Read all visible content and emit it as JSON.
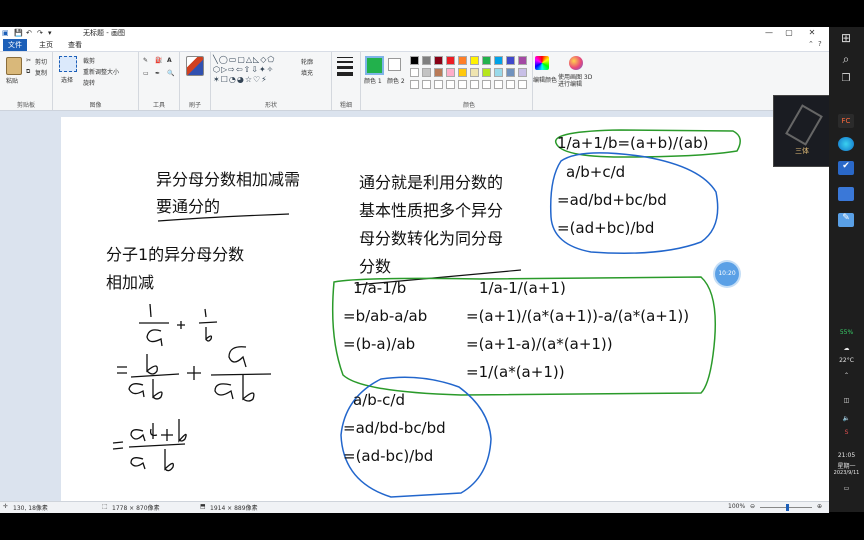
{
  "titlebar": {
    "title": "无标题 - 画图",
    "minimize": "—",
    "maximize": "▢",
    "close": "✕"
  },
  "tabs": {
    "file": "文件",
    "home": "主页",
    "view": "查看",
    "help": "?"
  },
  "ribbon": {
    "clipboard": {
      "paste": "粘贴",
      "cut": "剪切",
      "copy": "复制",
      "label": "剪贴板"
    },
    "image": {
      "select": "选择",
      "crop": "裁剪",
      "resize": "重新调整大小",
      "rotate": "旋转",
      "label": "图像"
    },
    "tools": {
      "label": "工具"
    },
    "brushes": {
      "label": "刷子"
    },
    "shapes": {
      "outline": "轮廓",
      "fill": "填充",
      "label": "形状"
    },
    "size": {
      "label": "粗细"
    },
    "color1": "颜色 1",
    "color2": "颜色 2",
    "colors_label": "颜色",
    "edit_colors": "编辑颜色",
    "paint3d": "使用画图 3D 进行编辑",
    "palette": [
      "#000000",
      "#7f7f7f",
      "#880015",
      "#ed1c24",
      "#ff7f27",
      "#fff200",
      "#22b14c",
      "#00a2e8",
      "#3f48cc",
      "#a349a4",
      "#ffffff",
      "#c3c3c3",
      "#b97a57",
      "#ffaec9",
      "#ffc90e",
      "#efe4b0",
      "#b5e61d",
      "#99d9ea",
      "#7092be",
      "#c8bfe7"
    ]
  },
  "canvas": {
    "note1_line1": "异分母分数相加减需",
    "note1_line2": "要通分的",
    "note2_line1": "分子1的异分母分数",
    "note2_line2": "相加减",
    "note3_line1": "通分就是利用分数的",
    "note3_line2": "基本性质把多个异分",
    "note3_line3": "母分数转化为同分母",
    "note3_line4": "分数",
    "formula_top": "1/a+1/b=(a+b)/(ab)",
    "add_lines": [
      "a/b+c/d",
      "=ad/bd+bc/bd",
      "=(ad+bc)/bd"
    ],
    "sub1_lines": [
      "1/a-1/b",
      "=b/ab-a/ab",
      "=(b-a)/ab"
    ],
    "sub2_lines": [
      "1/a-1/(a+1)",
      "=(a+1)/(a*(a+1))-a/(a*(a+1))",
      "=(a+1-a)/(a*(a+1))",
      "=1/(a*(a+1))"
    ],
    "sub3_lines": [
      "a/b-c/d",
      "=ad/bd-bc/bd",
      "=(ad-bc)/bd"
    ],
    "time_bubble": "10:20"
  },
  "statusbar": {
    "cursor_pos": "130, 18像素",
    "selection_size": "1778 × 870像素",
    "image_size": "1914 × 889像素",
    "zoom": "100%"
  },
  "taskbar": {
    "battery": "55%",
    "temperature": "22°C",
    "time": "21:05",
    "weekday": "星期一",
    "date": "2023/9/11",
    "thumb_label": "三体"
  }
}
